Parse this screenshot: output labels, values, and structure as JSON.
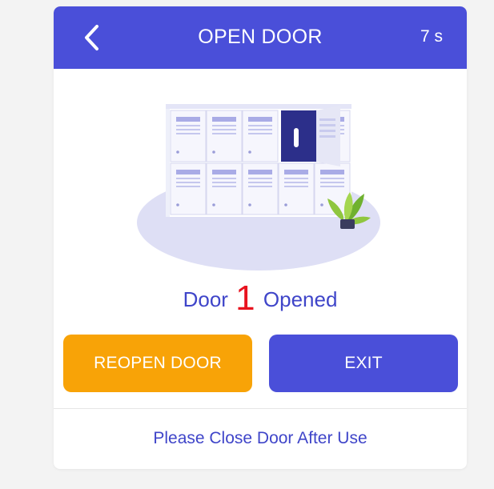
{
  "header": {
    "back_icon": "chevron-left-icon",
    "title": "OPEN DOOR",
    "timer": "7 s",
    "color": "#4a4fd9"
  },
  "illustration": {
    "icon": "locker-illustration",
    "plant_icon": "potted-plant-icon"
  },
  "status": {
    "prefix": "Door",
    "door_number": "1",
    "suffix": "Opened",
    "text_color": "#3f45c9",
    "number_color": "#e8131f"
  },
  "buttons": {
    "reopen_label": "REOPEN DOOR",
    "reopen_color": "#f8a307",
    "exit_label": "EXIT",
    "exit_color": "#4a4fd9"
  },
  "footer": {
    "message": "Please Close Door After Use"
  }
}
